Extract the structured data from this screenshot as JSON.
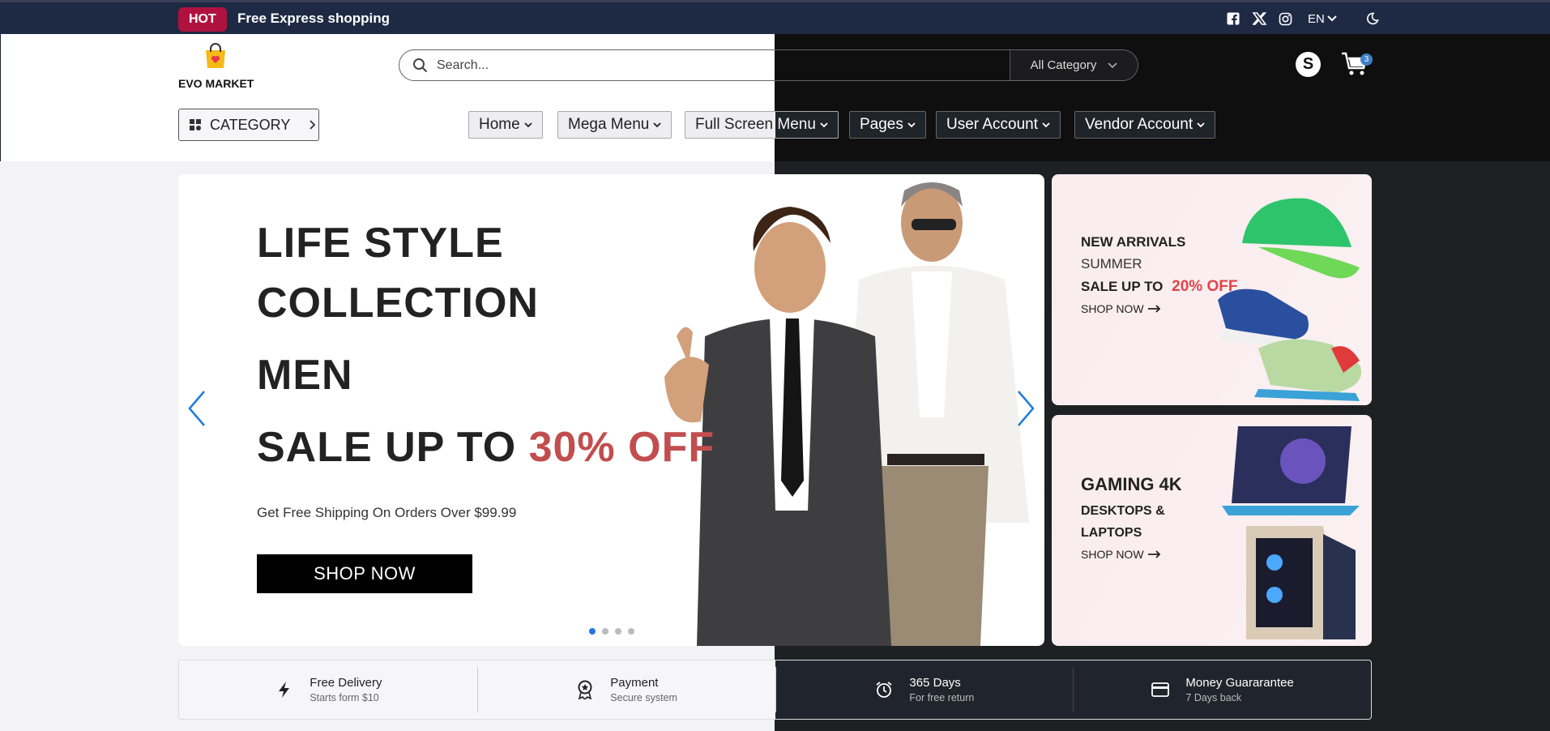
{
  "topbar": {
    "hot_label": "HOT",
    "promo": "Free Express shopping",
    "language": "EN",
    "icons": [
      "facebook-icon",
      "x-icon",
      "instagram-icon",
      "chevron-down-icon",
      "moon-icon"
    ]
  },
  "logo": {
    "text": "EVO MARKET"
  },
  "search": {
    "placeholder": "Search...",
    "category": "All Category"
  },
  "user": {
    "avatar_letter": "S",
    "cart_count": "3"
  },
  "nav": {
    "category_button": "CATEGORY",
    "items": [
      {
        "label": "Home"
      },
      {
        "label": "Mega Menu"
      },
      {
        "label": "Full Screen Menu"
      },
      {
        "label": "Pages"
      },
      {
        "label": "User Account"
      },
      {
        "label": "Vendor Account"
      }
    ]
  },
  "hero": {
    "line1": "LIFE STYLE",
    "line2": "COLLECTION",
    "line3": "MEN",
    "line4_prefix": "SALE UP TO ",
    "line4_highlight": "30% OFF",
    "subtitle": "Get Free Shipping On Orders Over $99.99",
    "button": "SHOP NOW",
    "slides_total": 4,
    "slide_active": 1
  },
  "banners": {
    "new_arrivals": {
      "title": "NEW ARRIVALS",
      "subtitle": "SUMMER",
      "sale_prefix": "SALE UP TO",
      "sale_highlight": "20% OFF",
      "link": "SHOP NOW"
    },
    "gaming": {
      "title": "GAMING 4K",
      "line1": "DESKTOPS &",
      "line2": "LAPTOPS",
      "link": "SHOP NOW"
    }
  },
  "features": [
    {
      "icon": "lightning-icon",
      "title": "Free Delivery",
      "sub": "Starts form $10"
    },
    {
      "icon": "badge-icon",
      "title": "Payment",
      "sub": "Secure system"
    },
    {
      "icon": "alarm-icon",
      "title": "365 Days",
      "sub": "For free return"
    },
    {
      "icon": "credit-card-icon",
      "title": "Money Guararantee",
      "sub": "7 Days back"
    }
  ],
  "colors": {
    "topbar": "#1e2a44",
    "hot": "#b0123f",
    "accent_red": "#c24d4f",
    "dark_half": "#0f0f10"
  }
}
